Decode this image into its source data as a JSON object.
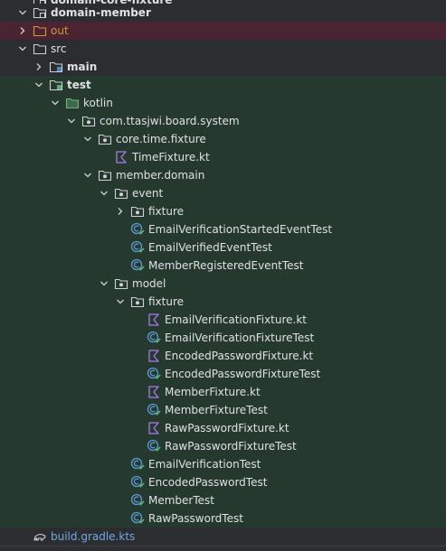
{
  "tree": {
    "items": [
      {
        "label": "domain-core-fixture",
        "icon": "module-folder-icon",
        "arrow": "none",
        "bg": "none",
        "bold": true,
        "color": "default"
      },
      {
        "label": "domain-member",
        "icon": "module-folder-icon",
        "arrow": "down",
        "bg": "none",
        "bold": true,
        "color": "default"
      },
      {
        "label": "out",
        "icon": "excluded-folder-icon",
        "arrow": "right",
        "bg": "excluded",
        "bold": false,
        "color": "orange"
      },
      {
        "label": "src",
        "icon": "folder-icon",
        "arrow": "down",
        "bg": "none",
        "bold": false,
        "color": "default"
      },
      {
        "label": "main",
        "icon": "source-folder-icon",
        "arrow": "right",
        "bg": "none",
        "bold": true,
        "color": "default"
      },
      {
        "label": "test",
        "icon": "test-folder-icon",
        "arrow": "down",
        "bg": "test",
        "bold": true,
        "color": "default"
      },
      {
        "label": "kotlin",
        "icon": "test-root-icon",
        "arrow": "down",
        "bg": "test",
        "bold": false,
        "color": "default"
      },
      {
        "label": "com.ttasjwi.board.system",
        "icon": "package-icon",
        "arrow": "down",
        "bg": "test",
        "bold": false,
        "color": "default"
      },
      {
        "label": "core.time.fixture",
        "icon": "package-icon",
        "arrow": "down",
        "bg": "test",
        "bold": false,
        "color": "default"
      },
      {
        "label": "TimeFixture.kt",
        "icon": "kotlin-file-icon",
        "arrow": "none",
        "bg": "test",
        "bold": false,
        "color": "default"
      },
      {
        "label": "member.domain",
        "icon": "package-icon",
        "arrow": "down",
        "bg": "test",
        "bold": false,
        "color": "default"
      },
      {
        "label": "event",
        "icon": "package-icon",
        "arrow": "down",
        "bg": "test",
        "bold": false,
        "color": "default"
      },
      {
        "label": "fixture",
        "icon": "package-icon",
        "arrow": "right",
        "bg": "test",
        "bold": false,
        "color": "default"
      },
      {
        "label": "EmailVerificationStartedEventTest",
        "icon": "test-class-icon",
        "arrow": "none",
        "bg": "test",
        "bold": false,
        "color": "default"
      },
      {
        "label": "EmailVerifiedEventTest",
        "icon": "test-class-icon",
        "arrow": "none",
        "bg": "test",
        "bold": false,
        "color": "default"
      },
      {
        "label": "MemberRegisteredEventTest",
        "icon": "test-class-icon",
        "arrow": "none",
        "bg": "test",
        "bold": false,
        "color": "default"
      },
      {
        "label": "model",
        "icon": "package-icon",
        "arrow": "down",
        "bg": "test",
        "bold": false,
        "color": "default"
      },
      {
        "label": "fixture",
        "icon": "package-icon",
        "arrow": "down",
        "bg": "test",
        "bold": false,
        "color": "default"
      },
      {
        "label": "EmailVerificationFixture.kt",
        "icon": "kotlin-file-icon",
        "arrow": "none",
        "bg": "test",
        "bold": false,
        "color": "default"
      },
      {
        "label": "EmailVerificationFixtureTest",
        "icon": "test-class-icon",
        "arrow": "none",
        "bg": "test",
        "bold": false,
        "color": "default"
      },
      {
        "label": "EncodedPasswordFixture.kt",
        "icon": "kotlin-file-icon",
        "arrow": "none",
        "bg": "test",
        "bold": false,
        "color": "default"
      },
      {
        "label": "EncodedPasswordFixtureTest",
        "icon": "test-class-icon",
        "arrow": "none",
        "bg": "test",
        "bold": false,
        "color": "default"
      },
      {
        "label": "MemberFixture.kt",
        "icon": "kotlin-file-icon",
        "arrow": "none",
        "bg": "test",
        "bold": false,
        "color": "default"
      },
      {
        "label": "MemberFixtureTest",
        "icon": "test-class-icon",
        "arrow": "none",
        "bg": "test",
        "bold": false,
        "color": "default"
      },
      {
        "label": "RawPasswordFixture.kt",
        "icon": "kotlin-file-icon",
        "arrow": "none",
        "bg": "test",
        "bold": false,
        "color": "default"
      },
      {
        "label": "RawPasswordFixtureTest",
        "icon": "test-class-icon",
        "arrow": "none",
        "bg": "test",
        "bold": false,
        "color": "default"
      },
      {
        "label": "EmailVerificationTest",
        "icon": "test-class-icon",
        "arrow": "none",
        "bg": "test",
        "bold": false,
        "color": "default"
      },
      {
        "label": "EncodedPasswordTest",
        "icon": "test-class-icon",
        "arrow": "none",
        "bg": "test",
        "bold": false,
        "color": "default"
      },
      {
        "label": "MemberTest",
        "icon": "test-class-icon",
        "arrow": "none",
        "bg": "test",
        "bold": false,
        "color": "default"
      },
      {
        "label": "RawPasswordTest",
        "icon": "test-class-icon",
        "arrow": "none",
        "bg": "test",
        "bold": false,
        "color": "default"
      },
      {
        "label": "build.gradle.kts",
        "icon": "gradle-icon",
        "arrow": "none",
        "bg": "none",
        "bold": false,
        "color": "blue"
      }
    ]
  },
  "colors": {
    "background": "#2b2d30",
    "excluded_row": "#4a2430",
    "test_row": "#26392f",
    "text": "#dfe1e5",
    "excluded_text": "#d6953e",
    "gradle_text": "#6fa8e6",
    "test_icon": "#5b9bd5",
    "kotlin_icon": "#a77de3"
  }
}
